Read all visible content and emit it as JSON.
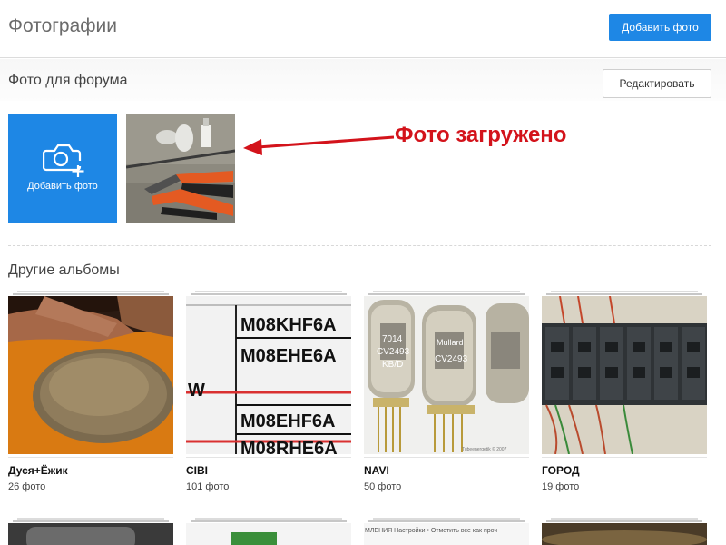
{
  "header": {
    "title": "Фотографии",
    "add_photo_button": "Добавить фото"
  },
  "forum_section": {
    "title": "Фото для форума",
    "edit_button": "Редактировать",
    "add_tile_label": "Добавить фото"
  },
  "annotation": {
    "text": "Фото загружено",
    "color": "#d3131b"
  },
  "other_albums": {
    "title": "Другие альбомы",
    "albums": [
      {
        "name": "Дуся+Ёжик",
        "count": "26 фото"
      },
      {
        "name": "CIBI",
        "count": "101 фото"
      },
      {
        "name": "NAVI",
        "count": "50 фото"
      },
      {
        "name": "ГОРОД",
        "count": "19 фото"
      }
    ]
  },
  "thumb_text": {
    "cibi_lines": [
      "M08KHF6A",
      "M08EHE6A",
      "W",
      "M08EHF6A",
      "M08RHE6A"
    ],
    "tube_labels": [
      "7014",
      "CV2493",
      "KB/D",
      "Mullard",
      "CV2493"
    ],
    "watermark": "Tubeenergetik © 2007",
    "row2_thumb_text": "МЛЕНИЯ   Настройки • Отметить все как проч"
  },
  "colors": {
    "accent": "#1e87e5",
    "annotation": "#d3131b"
  },
  "icons": {
    "add_photo": "camera-plus-icon"
  }
}
